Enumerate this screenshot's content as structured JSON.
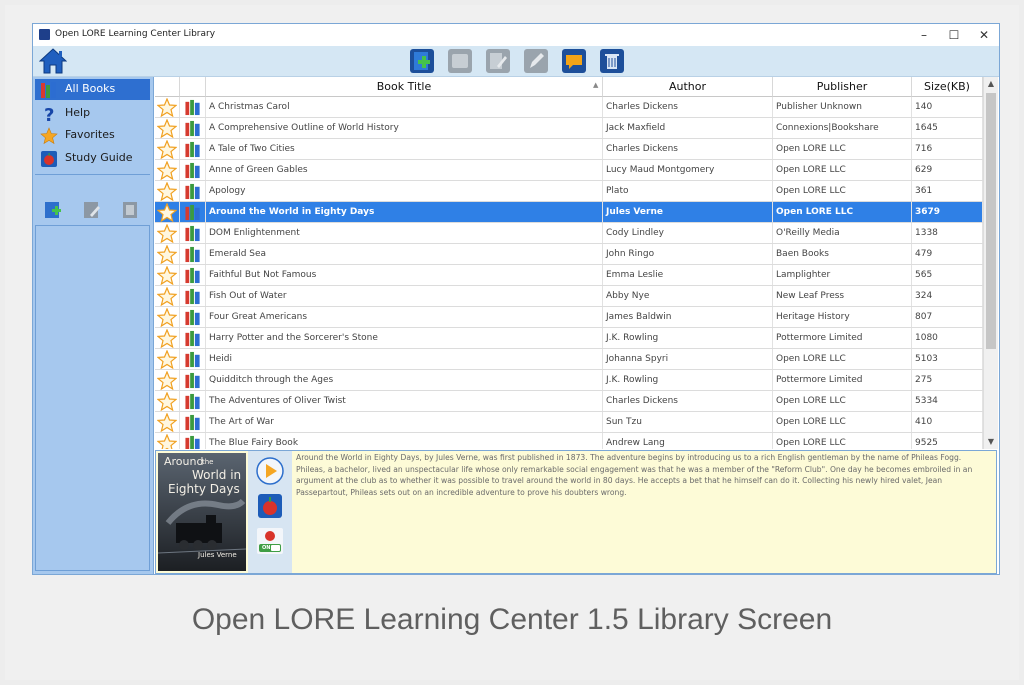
{
  "window": {
    "title": "Open LORE Learning Center Library",
    "minimize": "–",
    "maximize": "☐",
    "close": "✕"
  },
  "toolbar": {
    "buttons": [
      {
        "name": "add-book-icon"
      },
      {
        "name": "blank-book-icon"
      },
      {
        "name": "edit-book-disabled-icon"
      },
      {
        "name": "pencil-icon"
      },
      {
        "name": "comment-icon"
      },
      {
        "name": "trash-icon"
      }
    ]
  },
  "sidebar": {
    "items": [
      {
        "label": "All Books",
        "icon": "books-icon",
        "active": true
      },
      {
        "label": "Help",
        "icon": "question-icon",
        "active": false
      },
      {
        "label": "Favorites",
        "icon": "star-icon",
        "active": false
      },
      {
        "label": "Study Guide",
        "icon": "study-guide-icon",
        "active": false
      }
    ]
  },
  "table": {
    "columns": [
      "Book Title",
      "Author",
      "Publisher",
      "Size(KB)"
    ],
    "rows": [
      {
        "title": "A Christmas Carol",
        "author": "Charles Dickens",
        "publisher": "Publisher Unknown",
        "size": "140"
      },
      {
        "title": "A Comprehensive Outline of World History",
        "author": "Jack Maxfield",
        "publisher": "Connexions|Bookshare",
        "size": "1645"
      },
      {
        "title": "A Tale of Two Cities",
        "author": "Charles Dickens",
        "publisher": "Open LORE LLC",
        "size": "716"
      },
      {
        "title": "Anne of Green Gables",
        "author": "Lucy Maud Montgomery",
        "publisher": "Open LORE LLC",
        "size": "629"
      },
      {
        "title": "Apology",
        "author": "Plato",
        "publisher": "Open LORE LLC",
        "size": "361"
      },
      {
        "title": "Around the World in Eighty Days",
        "author": "Jules Verne",
        "publisher": "Open LORE LLC",
        "size": "3679",
        "selected": true
      },
      {
        "title": "DOM Enlightenment",
        "author": "Cody Lindley",
        "publisher": "O'Reilly Media",
        "size": "1338"
      },
      {
        "title": "Emerald Sea",
        "author": "John Ringo",
        "publisher": "Baen Books",
        "size": "479"
      },
      {
        "title": "Faithful But Not Famous",
        "author": "Emma Leslie",
        "publisher": "Lamplighter",
        "size": "565"
      },
      {
        "title": "Fish Out of Water",
        "author": "Abby Nye",
        "publisher": "New Leaf Press",
        "size": "324"
      },
      {
        "title": "Four Great Americans",
        "author": "James Baldwin",
        "publisher": "Heritage History",
        "size": "807"
      },
      {
        "title": "Harry Potter and the Sorcerer's Stone",
        "author": "J.K. Rowling",
        "publisher": "Pottermore Limited",
        "size": "1080"
      },
      {
        "title": "Heidi",
        "author": "Johanna Spyri",
        "publisher": "Open LORE LLC",
        "size": "5103"
      },
      {
        "title": "Quidditch through the Ages",
        "author": "J.K. Rowling",
        "publisher": "Pottermore Limited",
        "size": "275"
      },
      {
        "title": "The Adventures of Oliver Twist",
        "author": "Charles Dickens",
        "publisher": "Open LORE LLC",
        "size": "5334"
      },
      {
        "title": "The Art of War",
        "author": "Sun Tzu",
        "publisher": "Open LORE LLC",
        "size": "410"
      },
      {
        "title": "The Blue Fairy Book",
        "author": "Andrew Lang",
        "publisher": "Open LORE LLC",
        "size": "9525"
      }
    ]
  },
  "detail": {
    "cover": {
      "title_line1": "Around",
      "title_the": "the",
      "title_line2": "World in",
      "title_line3": "Eighty Days",
      "author": "Jules Verne"
    },
    "toggle_label": "ON",
    "description": "Around the World in Eighty Days, by Jules Verne, was first published in 1873. The adventure begins by introducing us to a rich English gentleman by the name of Phileas Fogg. Phileas, a bachelor, lived an unspectacular life whose only remarkable social engagement was that he was a member of the \"Reform Club\". One day he becomes embroiled in an argument at the club as to whether it was possible to travel around the world in 80 days. He accepts a bet that he himself can do it. Collecting his newly hired valet, Jean Passepartout, Phileas sets out on an incredible adventure to prove his doubters wrong."
  },
  "caption": "Open LORE Learning Center 1.5 Library Screen",
  "colors": {
    "accent": "#2f80e6",
    "sidebar": "#a6c8ee",
    "toolbar": "#d5e7f4",
    "detail_bg": "#fdfbd7"
  }
}
